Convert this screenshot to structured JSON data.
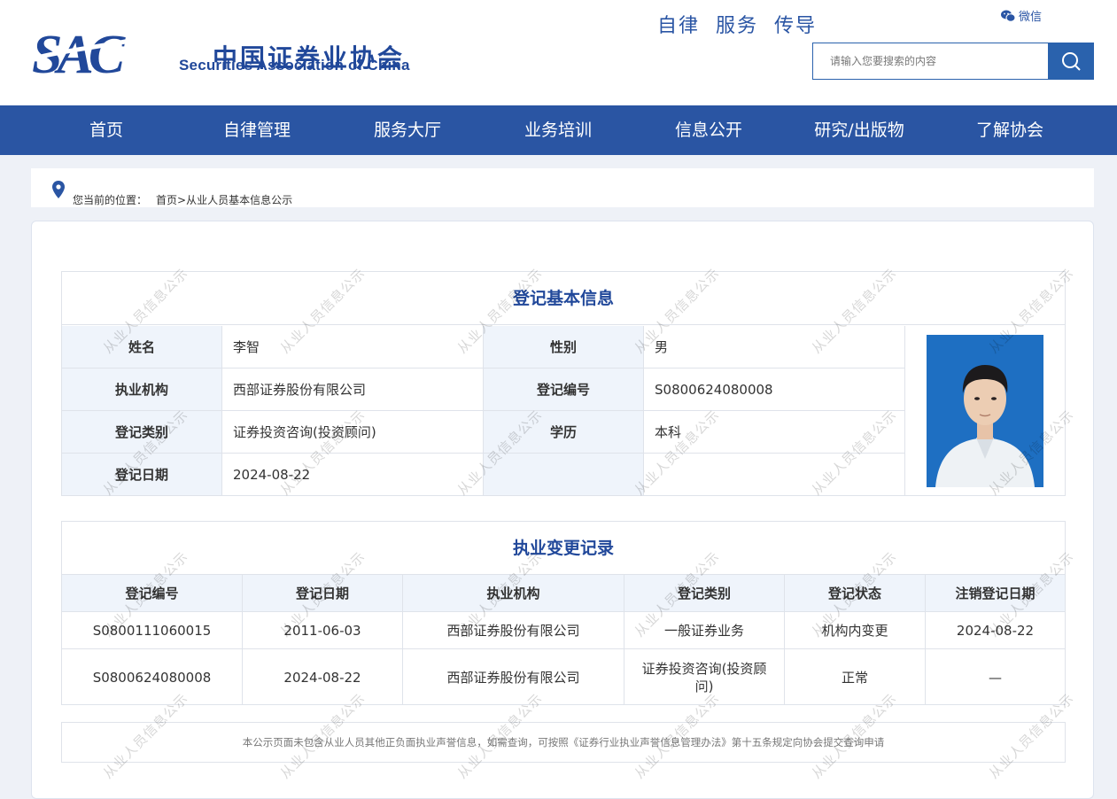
{
  "header": {
    "logo_cn": "中国证券业协会",
    "logo_en": "Securities Association of China",
    "slogan": "自律  服务  传导",
    "wechat_label": "微信",
    "search_placeholder": "请输入您要搜索的内容"
  },
  "nav": {
    "items": [
      "首页",
      "自律管理",
      "服务大厅",
      "业务培训",
      "信息公开",
      "研究/出版物",
      "了解协会"
    ]
  },
  "breadcrumb": {
    "prefix": "您当前的位置：",
    "home": "首页",
    "sep": ">",
    "current": "从业人员基本信息公示"
  },
  "basic_info": {
    "title": "登记基本信息",
    "name_label": "姓名",
    "name_value": "李智",
    "gender_label": "性别",
    "gender_value": "男",
    "org_label": "执业机构",
    "org_value": "西部证券股份有限公司",
    "reg_no_label": "登记编号",
    "reg_no_value": "S0800624080008",
    "category_label": "登记类别",
    "category_value": "证券投资咨询(投资顾问)",
    "edu_label": "学历",
    "edu_value": "本科",
    "date_label": "登记日期",
    "date_value": "2024-08-22"
  },
  "change_records": {
    "title": "执业变更记录",
    "headers": [
      "登记编号",
      "登记日期",
      "执业机构",
      "登记类别",
      "登记状态",
      "注销登记日期"
    ],
    "rows": [
      [
        "S0800111060015",
        "2011-06-03",
        "西部证券股份有限公司",
        "一般证券业务",
        "机构内变更",
        "2024-08-22"
      ],
      [
        "S0800624080008",
        "2024-08-22",
        "西部证券股份有限公司",
        "证券投资咨询(投资顾问)",
        "正常",
        "—"
      ]
    ]
  },
  "notice": "本公示页面未包含从业人员其他正负面执业声誉信息，如需查询，可按照《证券行业执业声誉信息管理办法》第十五条规定向协会提交查询申请",
  "watermark": "从业人员信息公示",
  "colors": {
    "brand_blue": "#2a55a3",
    "label_bg": "#eff4fb"
  }
}
